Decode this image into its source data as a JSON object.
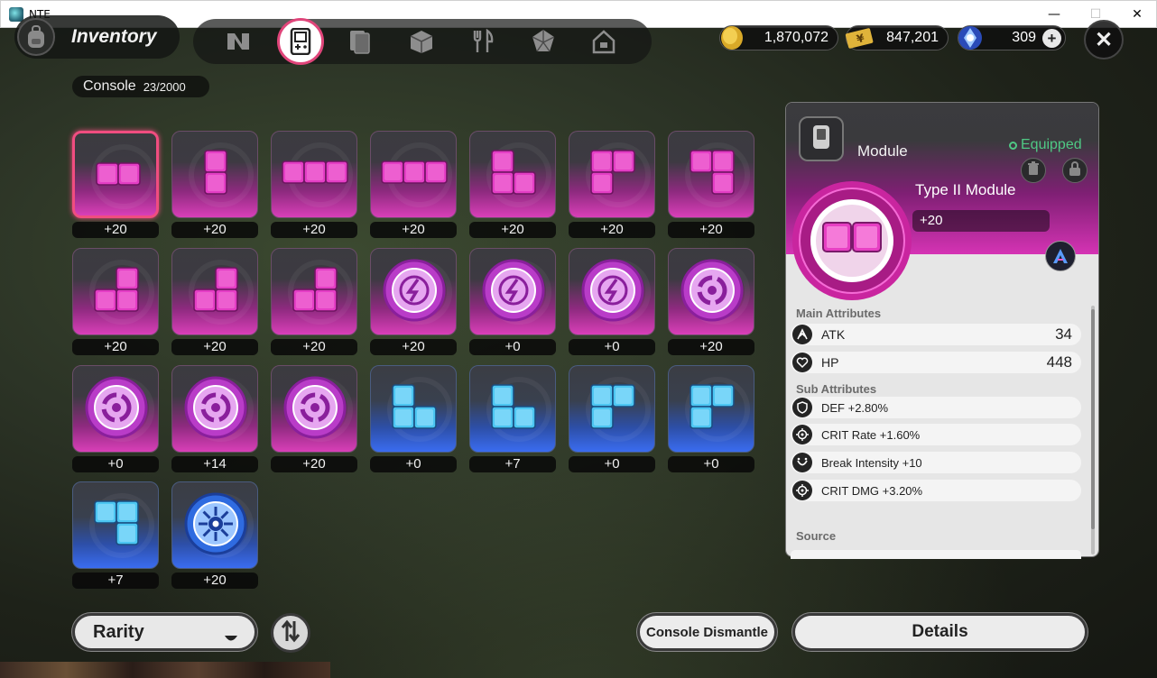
{
  "window": {
    "title": "NTE",
    "minimize": "—",
    "maximize": "☐",
    "close": "✕"
  },
  "header": {
    "title": "Inventory",
    "tabs": [
      {
        "icon": "n-logo-icon"
      },
      {
        "icon": "console-icon",
        "active": true
      },
      {
        "icon": "cards-icon"
      },
      {
        "icon": "box-icon"
      },
      {
        "icon": "utensils-icon"
      },
      {
        "icon": "cube-icon"
      },
      {
        "icon": "home-icon"
      }
    ],
    "currencies": [
      {
        "icon": "gold-coin-icon",
        "value": "1,870,072"
      },
      {
        "icon": "ticket-icon",
        "value": "847,201"
      },
      {
        "icon": "crystal-icon",
        "value": "309"
      }
    ],
    "close_label": "✕"
  },
  "console": {
    "label": "Console",
    "count": "23/2000"
  },
  "items": [
    {
      "shape": "h2",
      "color": "pink",
      "level": "+20",
      "selected": true
    },
    {
      "shape": "v2",
      "color": "pink",
      "level": "+20"
    },
    {
      "shape": "h3",
      "color": "pink",
      "level": "+20"
    },
    {
      "shape": "h3",
      "color": "pink",
      "level": "+20"
    },
    {
      "shape": "L",
      "color": "pink",
      "level": "+20"
    },
    {
      "shape": "r",
      "color": "pink",
      "level": "+20"
    },
    {
      "shape": "7",
      "color": "pink",
      "level": "+20"
    },
    {
      "shape": "J",
      "color": "pink",
      "level": "+20"
    },
    {
      "shape": "J",
      "color": "pink",
      "level": "+20"
    },
    {
      "shape": "J",
      "color": "pink",
      "level": "+20"
    },
    {
      "shape": "disc-bolt",
      "color": "pink",
      "level": "+20"
    },
    {
      "shape": "disc-bolt",
      "color": "pink",
      "level": "+0"
    },
    {
      "shape": "disc-bolt",
      "color": "pink",
      "level": "+0"
    },
    {
      "shape": "disc-ring",
      "color": "pink",
      "level": "+20"
    },
    {
      "shape": "disc-ring",
      "color": "pink",
      "level": "+0"
    },
    {
      "shape": "disc-ring",
      "color": "pink",
      "level": "+14"
    },
    {
      "shape": "disc-ring",
      "color": "pink",
      "level": "+20"
    },
    {
      "shape": "L",
      "color": "blue",
      "level": "+0"
    },
    {
      "shape": "L",
      "color": "blue",
      "level": "+7"
    },
    {
      "shape": "r",
      "color": "blue",
      "level": "+0"
    },
    {
      "shape": "r",
      "color": "blue",
      "level": "+0"
    },
    {
      "shape": "7",
      "color": "blue",
      "level": "+7"
    },
    {
      "shape": "disc-star",
      "color": "blue",
      "level": "+20"
    }
  ],
  "detail": {
    "tab_label": "Module",
    "status": "Equipped",
    "name": "Type II Module",
    "level": "+20",
    "main_title": "Main Attributes",
    "main": [
      {
        "icon": "atk-icon",
        "name": "ATK",
        "value": "34"
      },
      {
        "icon": "hp-icon",
        "name": "HP",
        "value": "448"
      }
    ],
    "sub_title": "Sub Attributes",
    "sub": [
      {
        "icon": "def-icon",
        "name": "DEF +2.80%"
      },
      {
        "icon": "crit-rate-icon",
        "name": "CRIT Rate +1.60%"
      },
      {
        "icon": "break-icon",
        "name": "Break Intensity +10"
      },
      {
        "icon": "crit-dmg-icon",
        "name": "CRIT DMG +3.20%"
      }
    ],
    "source_title": "Source"
  },
  "bottom": {
    "sort_label": "Rarity",
    "dismantle_label": "Console Dismantle",
    "details_label": "Details"
  },
  "colors": {
    "pink": "#e13fbf",
    "blue": "#3a6cf0",
    "selected": "#f04d80",
    "equipped": "#4fc884"
  }
}
